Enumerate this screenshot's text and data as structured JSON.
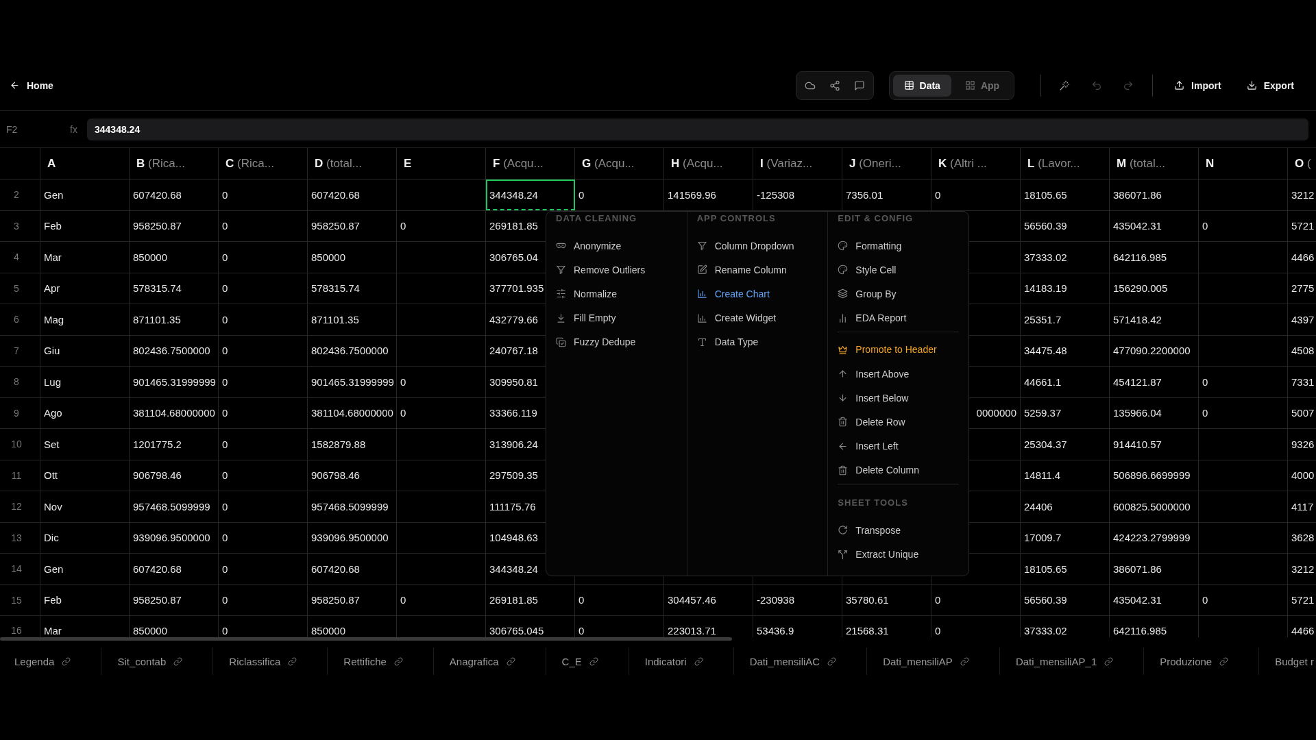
{
  "topbar": {
    "back": {
      "label": "Home"
    },
    "view_toggle": [
      {
        "label": "Data",
        "selected": true
      },
      {
        "label": "App",
        "selected": false
      }
    ],
    "undo": {
      "disabled": true
    },
    "redo": {
      "disabled": true
    },
    "buttons": [
      "Import",
      "Export"
    ]
  },
  "formula_bar": {
    "cell_ref": "F2",
    "fx_label": "fx",
    "value": "344348.24"
  },
  "grid": {
    "columns": [
      {
        "letter": "A"
      },
      {
        "letter": "B",
        "name": "(Rica..."
      },
      {
        "letter": "C",
        "name": "(Rica..."
      },
      {
        "letter": "D",
        "name": "(total..."
      },
      {
        "letter": "E"
      },
      {
        "letter": "F",
        "name": "(Acqu..."
      },
      {
        "letter": "G",
        "name": "(Acqu..."
      },
      {
        "letter": "H",
        "name": "(Acqu..."
      },
      {
        "letter": "I",
        "name": "(Variaz..."
      },
      {
        "letter": "J",
        "name": "(Oneri..."
      },
      {
        "letter": "K",
        "name": "(Altri ..."
      },
      {
        "letter": "L",
        "name": "(Lavor..."
      },
      {
        "letter": "M",
        "name": "(total..."
      },
      {
        "letter": "N"
      },
      {
        "letter": "O",
        "name": "("
      }
    ],
    "rows": [
      {
        "number": "2",
        "cells": [
          "Gen",
          "607420.68",
          "0",
          "607420.68",
          null,
          {
            "text": "344348.24",
            "selected": true
          },
          "0",
          "141569.96",
          "-125308",
          "7356.01",
          "0",
          "18105.65",
          "386071.86",
          null,
          "3212"
        ]
      },
      {
        "number": "3",
        "cells": [
          "Feb",
          "958250.87",
          "0",
          "958250.87",
          "0",
          "269181.85",
          null,
          null,
          null,
          null,
          null,
          "56560.39",
          "435042.31",
          "0",
          "5721"
        ]
      },
      {
        "number": "4",
        "cells": [
          "Mar",
          "850000",
          "0",
          "850000",
          null,
          "306765.04",
          null,
          null,
          null,
          null,
          null,
          "37333.02",
          "642116.985",
          null,
          "4466"
        ]
      },
      {
        "number": "5",
        "cells": [
          "Apr",
          "578315.74",
          "0",
          "578315.74",
          null,
          "377701.935",
          null,
          null,
          null,
          null,
          null,
          "14183.19",
          "156290.005",
          null,
          "2775"
        ]
      },
      {
        "number": "6",
        "cells": [
          "Mag",
          "871101.35",
          "0",
          "871101.35",
          null,
          "432779.66",
          null,
          null,
          null,
          null,
          null,
          "25351.7",
          "571418.42",
          null,
          "4397"
        ]
      },
      {
        "number": "7",
        "cells": [
          "Giu",
          "802436.7500000",
          "0",
          "802436.7500000",
          null,
          "240767.18",
          null,
          null,
          null,
          null,
          null,
          "34475.48",
          "477090.2200000",
          null,
          "4508"
        ]
      },
      {
        "number": "8",
        "cells": [
          "Lug",
          "901465.31999999",
          "0",
          "901465.31999999",
          "0",
          "309950.81",
          null,
          null,
          null,
          null,
          null,
          "44661.1",
          "454121.87",
          "0",
          "7331"
        ]
      },
      {
        "number": "9",
        "cells": [
          "Ago",
          "381104.68000000",
          "0",
          "381104.68000000",
          "0",
          "33366.119",
          null,
          null,
          null,
          null,
          {
            "text": "0000000",
            "cut_start": true
          },
          "5259.37",
          "135966.04",
          "0",
          "5007"
        ]
      },
      {
        "number": "10",
        "cells": [
          "Set",
          "1201775.2",
          "0",
          "1582879.88",
          null,
          "313906.24",
          null,
          null,
          null,
          null,
          null,
          "25304.37",
          "914410.57",
          null,
          "9326"
        ]
      },
      {
        "number": "11",
        "cells": [
          "Ott",
          "906798.46",
          "0",
          "906798.46",
          null,
          "297509.35",
          null,
          null,
          null,
          null,
          null,
          "14811.4",
          "506896.6699999",
          null,
          "4000"
        ]
      },
      {
        "number": "12",
        "cells": [
          "Nov",
          "957468.5099999",
          "0",
          "957468.5099999",
          null,
          "111175.76",
          null,
          null,
          null,
          null,
          null,
          "24406",
          "600825.5000000",
          null,
          "4117"
        ]
      },
      {
        "number": "13",
        "cells": [
          "Dic",
          "939096.9500000",
          "0",
          "939096.9500000",
          null,
          "104948.63",
          null,
          null,
          null,
          null,
          null,
          "17009.7",
          "424223.2799999",
          null,
          "3628"
        ]
      },
      {
        "number": "14",
        "cells": [
          "Gen",
          "607420.68",
          "0",
          "607420.68",
          null,
          "344348.24",
          null,
          null,
          null,
          null,
          null,
          "18105.65",
          "386071.86",
          null,
          "3212"
        ]
      },
      {
        "number": "15",
        "cells": [
          "Feb",
          "958250.87",
          "0",
          "958250.87",
          "0",
          "269181.85",
          "0",
          "304457.46",
          "-230938",
          "35780.61",
          "0",
          "56560.39",
          "435042.31",
          "0",
          "5721"
        ]
      },
      {
        "number": "16",
        "cells": [
          "Mar",
          "850000",
          "0",
          "850000",
          null,
          "306765.045",
          "0",
          "223013.71",
          "53436.9",
          "21568.31",
          "0",
          "37333.02",
          "642116.985",
          null,
          "4466"
        ]
      }
    ]
  },
  "context_menu": {
    "columns": [
      {
        "sections": [
          {
            "title": "DATA CLEANING",
            "items": [
              {
                "label": "Anonymize"
              },
              {
                "label": "Remove Outliers"
              },
              {
                "label": "Normalize"
              },
              {
                "label": "Fill Empty"
              },
              {
                "label": "Fuzzy Dedupe"
              }
            ]
          }
        ]
      },
      {
        "sections": [
          {
            "title": "APP CONTROLS",
            "items": [
              {
                "label": "Column Dropdown"
              },
              {
                "label": "Rename Column"
              },
              {
                "label": "Create Chart",
                "color": "#63a4f8"
              },
              {
                "label": "Create Widget"
              },
              {
                "label": "Data Type"
              }
            ]
          }
        ]
      },
      {
        "sections": [
          {
            "title": "EDIT & CONFIG",
            "items": [
              {
                "label": "Formatting"
              },
              {
                "label": "Style Cell"
              },
              {
                "label": "Group By"
              },
              {
                "label": "EDA Report"
              }
            ]
          },
          {
            "items": [
              {
                "label": "Promote to Header",
                "color": "#f5a524"
              },
              {
                "label": "Insert Above"
              },
              {
                "label": "Insert Below"
              },
              {
                "label": "Delete Row"
              },
              {
                "label": "Insert Left"
              },
              {
                "label": "Delete Column"
              }
            ]
          },
          {
            "title": "SHEET TOOLS",
            "items": [
              {
                "label": "Transpose"
              },
              {
                "label": "Extract Unique"
              }
            ]
          }
        ]
      }
    ]
  },
  "sheet_tabs": [
    {
      "label": "Legenda",
      "link": true
    },
    {
      "label": "Sit_contab",
      "link": true
    },
    {
      "label": "Riclassifica",
      "link": true
    },
    {
      "label": "Rettifiche",
      "link": true
    },
    {
      "label": "Anagrafica",
      "link": true
    },
    {
      "label": "C_E",
      "link": true
    },
    {
      "label": "Indicatori",
      "link": true
    },
    {
      "label": "Dati_mensiliAC",
      "link": true
    },
    {
      "label": "Dati_mensiliAP",
      "link": true
    },
    {
      "label": "Dati_mensiliAP_1",
      "link": true
    },
    {
      "label": "Produzione",
      "link": true
    },
    {
      "label": "Budget r",
      "link": false
    }
  ]
}
